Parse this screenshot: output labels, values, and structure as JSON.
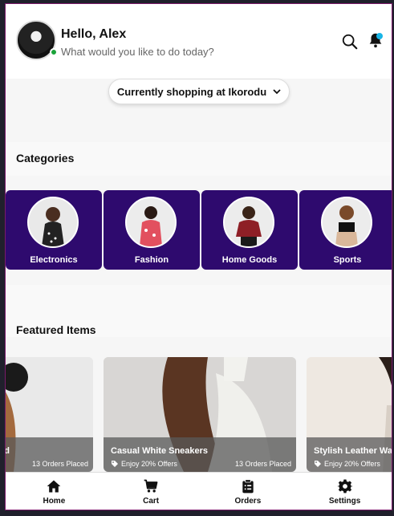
{
  "header": {
    "greeting": "Hello, Alex",
    "subtitle": "What would you like to do today?"
  },
  "location": {
    "label": "Currently shopping at Ikorodu"
  },
  "categories": {
    "title": "Categories",
    "items": [
      {
        "label": "Electronics"
      },
      {
        "label": "Fashion"
      },
      {
        "label": "Home Goods"
      },
      {
        "label": "Sports"
      }
    ]
  },
  "featured": {
    "title": "Featured Items",
    "items": [
      {
        "name": "rd",
        "offer": "",
        "orders": "13 Orders Placed"
      },
      {
        "name": "Casual White Sneakers",
        "offer": "Enjoy 20% Offers",
        "orders": "13 Orders Placed"
      },
      {
        "name": "Stylish Leather Wal",
        "offer": "Enjoy 20% Offers",
        "orders": ""
      }
    ]
  },
  "nav": {
    "items": [
      {
        "label": "Home",
        "icon": "home-icon"
      },
      {
        "label": "Cart",
        "icon": "cart-icon"
      },
      {
        "label": "Orders",
        "icon": "clipboard-icon"
      },
      {
        "label": "Settings",
        "icon": "gear-icon"
      }
    ]
  },
  "colors": {
    "category_bg": "#2e0a6e",
    "online": "#1aa33a",
    "notification": "#19b5e6"
  }
}
